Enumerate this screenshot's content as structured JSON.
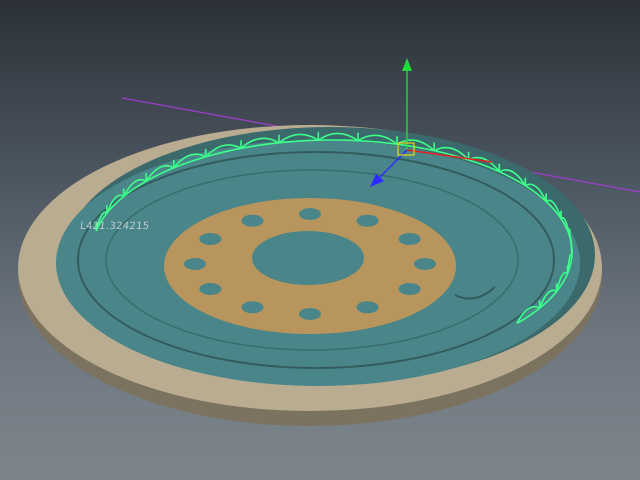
{
  "viewport": {
    "name": "3d-perspective-viewport",
    "surface_label": "L421.324215"
  },
  "colors": {
    "background_top": "#2c3138",
    "background_bottom": "#7d858c",
    "outer_rim": "#b9ac90",
    "rim_shadow": "#7b735f",
    "recess_surface": "#4a8689",
    "hub_plate": "#b8955c",
    "selection_green": "#3cff8a",
    "axis_y": "#1ddc39",
    "axis_z": "#2a2cff",
    "axis_x": "#e02020",
    "guide_line": "#a03cd2"
  },
  "gizmo": {
    "type": "move-manipulator",
    "axes": [
      "y",
      "z",
      "x"
    ]
  },
  "hub": {
    "bolt_hole_count": 12
  }
}
